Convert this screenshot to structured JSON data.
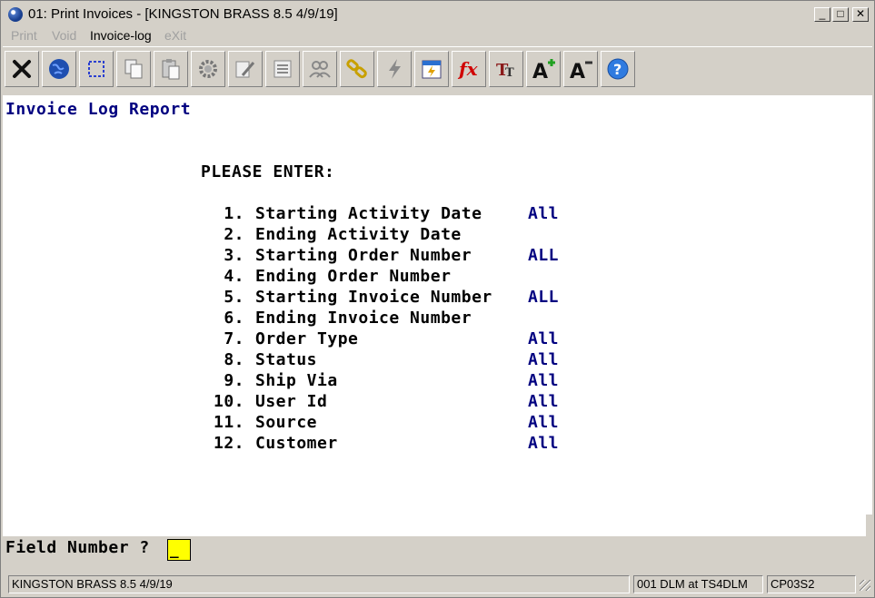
{
  "window": {
    "title": "01: Print Invoices - [KINGSTON BRASS 8.5 4/9/19]",
    "controls": {
      "minimize": "_",
      "maximize": "□",
      "close": "✕"
    }
  },
  "menu": [
    {
      "label": "Print",
      "enabled": false
    },
    {
      "label": "Void",
      "enabled": false
    },
    {
      "label": "Invoice-log",
      "enabled": true
    },
    {
      "label": "eXit",
      "enabled": false
    }
  ],
  "toolbar": [
    {
      "name": "cancel-icon"
    },
    {
      "name": "globe-icon"
    },
    {
      "name": "select-icon"
    },
    {
      "name": "copy-icon"
    },
    {
      "name": "paste-icon"
    },
    {
      "name": "settings-icon"
    },
    {
      "name": "edit-icon"
    },
    {
      "name": "list-icon"
    },
    {
      "name": "users-icon"
    },
    {
      "name": "link-icon"
    },
    {
      "name": "lightning-icon"
    },
    {
      "name": "calendar-icon"
    },
    {
      "name": "function-icon"
    },
    {
      "name": "font-icon"
    },
    {
      "name": "font-increase-icon"
    },
    {
      "name": "font-decrease-icon"
    },
    {
      "name": "help-icon"
    }
  ],
  "screen": {
    "title": "Invoice Log Report",
    "prompt_header": "PLEASE ENTER:",
    "fields": [
      {
        "num": "1.",
        "label": "Starting Activity Date",
        "value": "All"
      },
      {
        "num": "2.",
        "label": "Ending Activity Date",
        "value": ""
      },
      {
        "num": "3.",
        "label": "Starting Order Number",
        "value": "ALL"
      },
      {
        "num": "4.",
        "label": "Ending Order Number",
        "value": ""
      },
      {
        "num": "5.",
        "label": "Starting Invoice Number",
        "value": "ALL"
      },
      {
        "num": "6.",
        "label": "Ending Invoice Number",
        "value": ""
      },
      {
        "num": "7.",
        "label": "Order Type",
        "value": "All"
      },
      {
        "num": "8.",
        "label": "Status",
        "value": "All"
      },
      {
        "num": "9.",
        "label": "Ship Via",
        "value": "All"
      },
      {
        "num": "10.",
        "label": "User Id",
        "value": "All"
      },
      {
        "num": "11.",
        "label": "Source",
        "value": "All"
      },
      {
        "num": "12.",
        "label": "Customer",
        "value": "All"
      }
    ]
  },
  "prompt": {
    "label": "Field Number ?",
    "value": "_"
  },
  "status": {
    "company": "KINGSTON BRASS 8.5 4/9/19",
    "session": "001 DLM at TS4DLM",
    "code": "CP03S2"
  },
  "colors": {
    "value_text": "#000080",
    "input_bg": "#ffff00",
    "chrome": "#d4d0c8"
  }
}
